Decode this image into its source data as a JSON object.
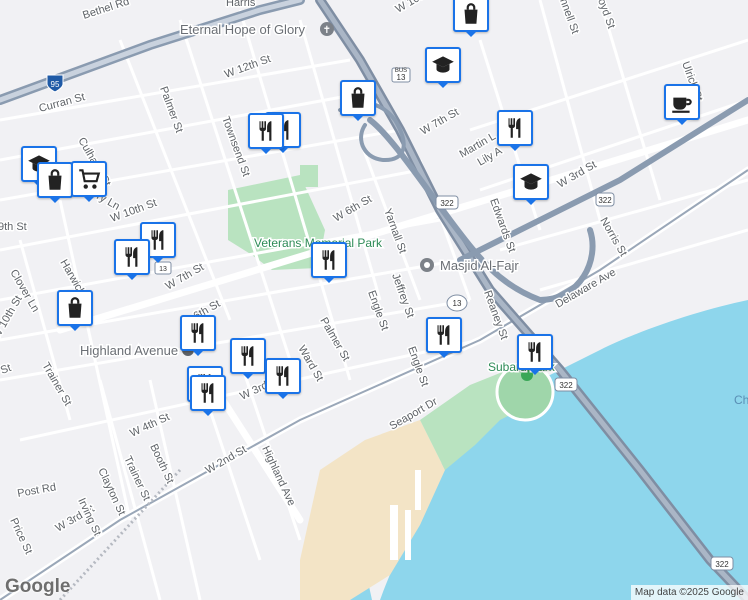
{
  "map": {
    "attribution": "Map data ©2025 Google",
    "logo": "Google",
    "colors": {
      "background": "#f1f1f4",
      "water": "#8ed6ec",
      "park": "#b9e3c0",
      "sand": "#f3e4c6",
      "highway": "#8a9bb0",
      "road_major": "#ffffff",
      "marker_border": "#1a73e8"
    },
    "labels": {
      "bethel_rd": "Bethel Rd",
      "harris": "Harris",
      "eternal_hope": "Eternal Hope of Glory",
      "w10th_top": "W 10th St",
      "w12th": "W 12th St",
      "palmer_top": "Palmer St",
      "curran": "Curran St",
      "townsend": "Townsend St",
      "w7th_top": "W 7th St",
      "martin": "Martin L",
      "lily": "Lily A",
      "culhane": "Culhane St",
      "w9th_left": "9th St",
      "w10th_left": "W 10th St",
      "ry_ln": "ry Ln",
      "w6th": "W 6th St",
      "yarnall": "Yarnall St",
      "edwards": "Edwards St",
      "w3rd_right": "W 3rd St",
      "norris": "Norris St",
      "ulrich": "Ulrich St",
      "veterans": "Veterans Memorial Park",
      "masjid": "Masjid Al-Fajr",
      "delaware": "Delaware Ave",
      "harwick": "Harwick",
      "clover": "Clover Ln",
      "w8th_left": "8th St",
      "w7th_left": "W 7th St",
      "w6th_left": "6th St",
      "w10th_far": "W 10th St",
      "jeffrey": "Jeffrey St",
      "reaney": "Reaney St",
      "engle_main": "Engle St",
      "engle_lower": "Engle St",
      "palmer_lower": "Palmer St",
      "ward": "Ward St",
      "highland_ave_station": "Highland Avenue",
      "subaru": "Subaru Park",
      "trainer_left": "Trainer St",
      "st_left": "St",
      "w4th": "W 4th St",
      "w3rd_mid": "W 3rd",
      "seaport": "Seaport Dr",
      "w2nd": "W 2nd St",
      "highland_ave": "Highland Ave",
      "booth": "Booth St",
      "trainer_lower": "Trainer St",
      "clayton": "Clayton St",
      "post_rd": "Post Rd",
      "w3rd_lower": "W 3rd St",
      "irving": "Irving St",
      "price": "Price St",
      "ch": "Ch",
      "rt95": "95",
      "rt13a": "13",
      "rt13b": "13",
      "rt13c": "13",
      "rt322a": "322",
      "rt322b": "322",
      "rt322c": "322",
      "rt322d": "322",
      "rt13d": "13",
      "bus": "BUS",
      "rt13e": "13",
      "nnell": "nnell St",
      "oyd": "oyd St"
    },
    "markers": [
      {
        "icon": "shopping-bag-icon"
      },
      {
        "icon": "graduation-cap-icon"
      },
      {
        "icon": "shopping-bag-icon"
      },
      {
        "icon": "coffee-cup-icon"
      },
      {
        "icon": "restaurant-icon"
      },
      {
        "icon": "restaurant-icon"
      },
      {
        "icon": "restaurant-icon"
      },
      {
        "icon": "graduation-cap-icon"
      },
      {
        "icon": "graduation-cap-icon"
      },
      {
        "icon": "shopping-bag-icon"
      },
      {
        "icon": "shopping-cart-icon"
      },
      {
        "icon": "restaurant-icon"
      },
      {
        "icon": "restaurant-icon"
      },
      {
        "icon": "restaurant-icon"
      },
      {
        "icon": "shopping-bag-icon"
      },
      {
        "icon": "restaurant-icon"
      },
      {
        "icon": "restaurant-icon"
      },
      {
        "icon": "restaurant-icon"
      },
      {
        "icon": "restaurant-icon"
      },
      {
        "icon": "restaurant-icon"
      },
      {
        "icon": "restaurant-icon"
      },
      {
        "icon": "restaurant-icon"
      }
    ]
  }
}
